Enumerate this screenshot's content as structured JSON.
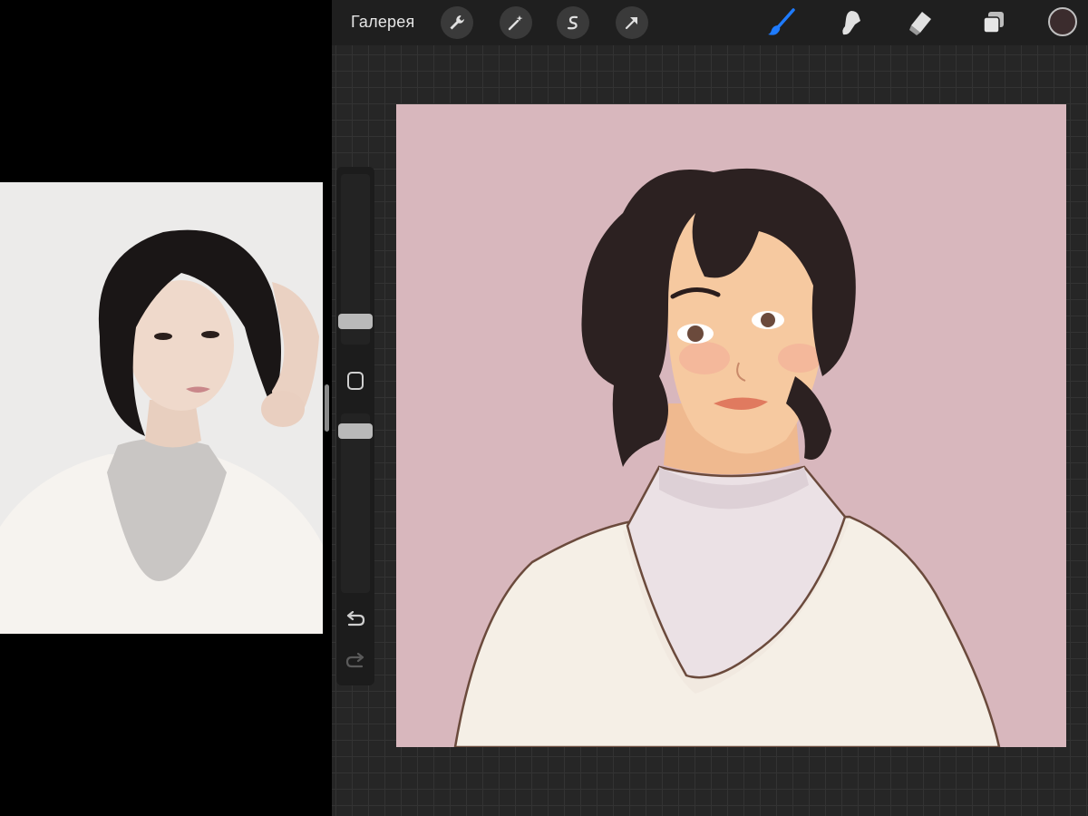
{
  "topbar": {
    "gallery_label": "Галерея",
    "tools": [
      "wrench-icon",
      "magic-wand-icon",
      "selection-s-icon",
      "transform-arrow-icon",
      "brush-icon",
      "smudge-icon",
      "eraser-icon",
      "layers-icon"
    ],
    "current_color": "#3b2c2d",
    "active_tool_color": "#1e7bff"
  },
  "sidebar": {
    "brush_size": 0.18,
    "opacity": 0.03
  },
  "canvas": {
    "background_color": "#d8b7bd"
  }
}
